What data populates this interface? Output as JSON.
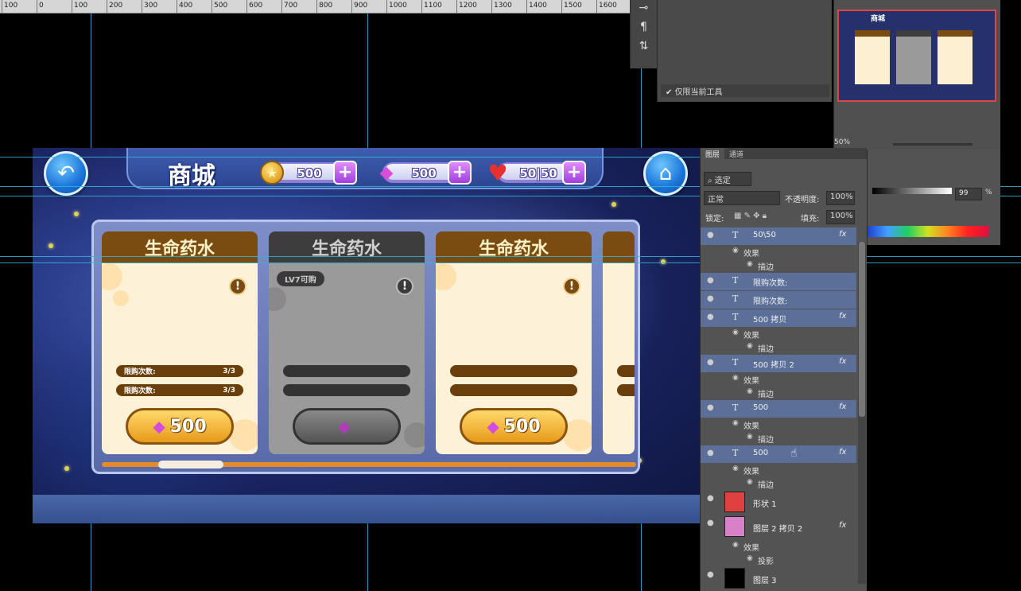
{
  "ruler": {
    "labels": [
      "100",
      "0",
      "100",
      "200",
      "300",
      "400",
      "500",
      "600",
      "700",
      "800",
      "900",
      "1000",
      "1100",
      "1200",
      "1300",
      "1400",
      "1500",
      "1600"
    ]
  },
  "game": {
    "title": "商城",
    "resources": [
      {
        "icon": "coin-icon",
        "value": "500"
      },
      {
        "icon": "gem-icon",
        "value": "500"
      },
      {
        "icon": "heart-icon",
        "value": "50|50"
      }
    ],
    "plus_label": "+",
    "cards": [
      {
        "title": "生命药水",
        "style": "orange",
        "limits": [
          {
            "label": "限购次数:",
            "value": "3/3"
          },
          {
            "label": "限购次数:",
            "value": "3/3"
          }
        ],
        "price": "500"
      },
      {
        "title": "生命药水",
        "style": "gray",
        "badge": "LV7可购",
        "limits": [
          {
            "label": "",
            "value": ""
          },
          {
            "label": "",
            "value": ""
          }
        ],
        "price": ""
      },
      {
        "title": "生命药水",
        "style": "orange",
        "limits": [
          {
            "label": "",
            "value": ""
          },
          {
            "label": "",
            "value": ""
          }
        ],
        "price": "500"
      }
    ],
    "info_glyph": "!",
    "scroll_progress": 0.12
  },
  "ps_tool": {
    "footer_label": "仅限当前工具"
  },
  "ps_nav": {
    "zoom": "50%",
    "thumb_title": "商城"
  },
  "ps_layers": {
    "tabs": [
      "图层",
      "通道"
    ],
    "search_placeholder": "选定",
    "blend_mode": "正常",
    "opacity_label": "不透明度:",
    "opacity_value": "100%",
    "lock_label": "锁定:",
    "fill_label": "填充:",
    "fill_value": "100%",
    "effects_label": "效果",
    "stroke_label": "描边",
    "shadow_label": "投影",
    "layers": [
      {
        "name": "50\\50",
        "type": "text",
        "fx": true,
        "highlighted": true
      },
      {
        "name": "限购次数:",
        "type": "text",
        "fx": false,
        "highlighted": true
      },
      {
        "name": "限购次数:",
        "type": "text",
        "fx": false,
        "highlighted": true
      },
      {
        "name": "500 拷贝",
        "type": "text",
        "fx": true,
        "highlighted": true
      },
      {
        "name": "500 拷贝 2",
        "type": "text",
        "fx": true,
        "highlighted": true
      },
      {
        "name": "500",
        "type": "text",
        "fx": true,
        "highlighted": true
      },
      {
        "name": "500",
        "type": "text",
        "fx": true,
        "highlighted": true
      },
      {
        "name": "形状 1",
        "type": "shape",
        "fx": false,
        "highlighted": false
      },
      {
        "name": "图层 2 拷贝 2",
        "type": "image",
        "fx": true,
        "highlighted": false
      },
      {
        "name": "图层 3",
        "type": "image",
        "fx": false,
        "highlighted": false
      }
    ]
  },
  "ps_color": {
    "value": "99",
    "unit": "%"
  }
}
